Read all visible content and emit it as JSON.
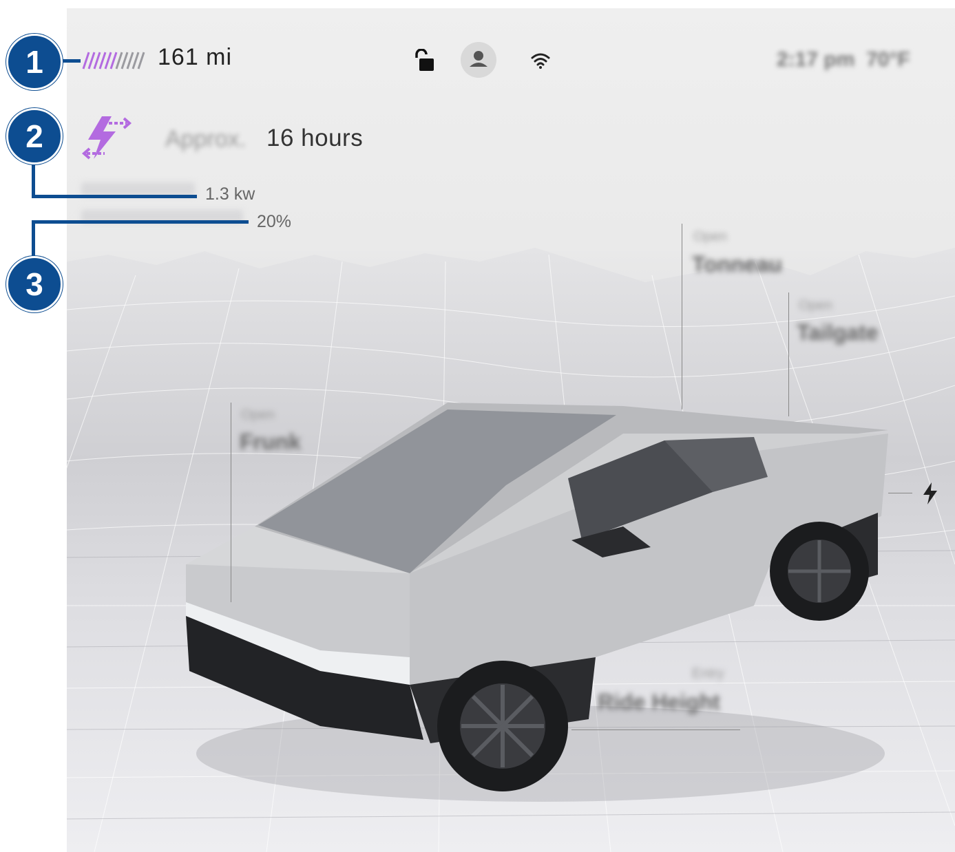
{
  "status_bar": {
    "range": "161 mi",
    "battery_icon": "battery-stripes-icon",
    "lock_icon": "unlocked-padlock-icon",
    "profile_icon": "driver-profile-icon",
    "wifi_icon": "wifi-icon",
    "time": "2:17 pm",
    "temperature": "70°F"
  },
  "powershare": {
    "icon": "bidirectional-charge-icon",
    "approx_label": "Approx.",
    "duration": "16 hours",
    "power": "1.3 kw",
    "reserve_percent": "20%"
  },
  "callouts": [
    "1",
    "2",
    "3"
  ],
  "vehicle_controls": {
    "frunk": {
      "state": "Open",
      "label": "Frunk"
    },
    "tonneau": {
      "state": "Open",
      "label": "Tonneau"
    },
    "tailgate": {
      "state": "Open",
      "label": "Tailgate"
    },
    "ride_height": {
      "state": "Entry",
      "label": "Ride Height"
    },
    "charge_port_icon": "lightning-bolt-icon"
  },
  "colors": {
    "callout": "#0d4d91",
    "accent": "#b36be0",
    "background": "#eaeaea"
  }
}
